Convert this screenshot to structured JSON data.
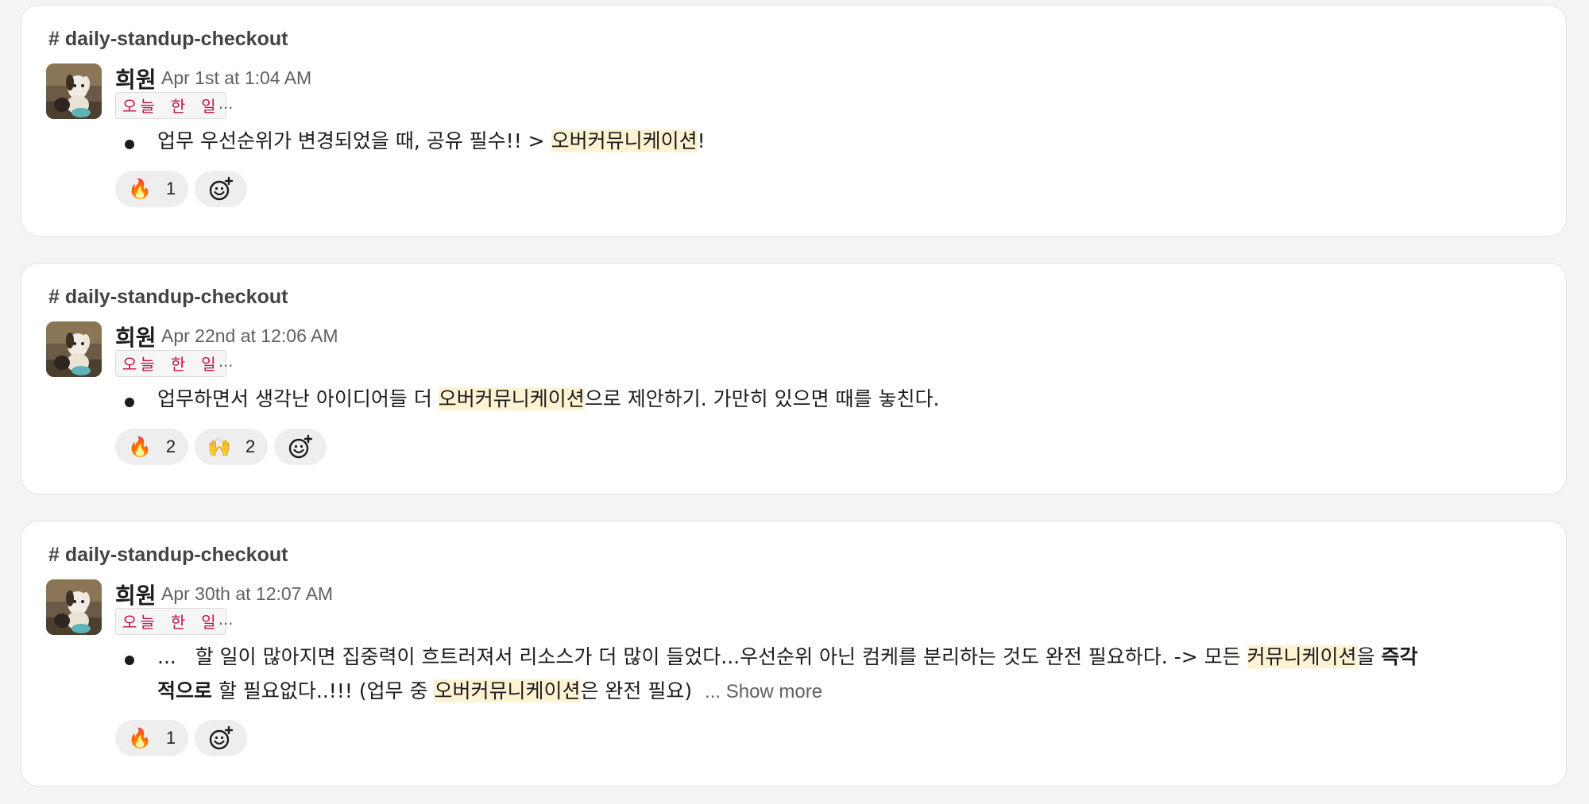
{
  "messages": [
    {
      "channel": "# daily-standup-checkout",
      "author": "희원",
      "timestamp": "Apr 1st at 1:04 AM",
      "tag": "오늘 한 일",
      "ellipsis": "...",
      "text": {
        "p1": "업무 우선순위가 변경되었을 때, 공유 필수!! > ",
        "hl1": "오버커뮤니케이션",
        "p2": "!"
      },
      "reactions": [
        {
          "emoji": "🔥",
          "count": "1"
        }
      ]
    },
    {
      "channel": "# daily-standup-checkout",
      "author": "희원",
      "timestamp": "Apr 22nd at 12:06 AM",
      "tag": "오늘 한 일",
      "ellipsis": "...",
      "text": {
        "p1": "업무하면서 생각난 아이디어들 더 ",
        "hl1": "오버커뮤니케이션",
        "p2": "으로 제안하기. 가만히 있으면 때를 놓친다."
      },
      "reactions": [
        {
          "emoji": "🔥",
          "count": "2"
        },
        {
          "emoji": "🙌",
          "count": "2"
        }
      ]
    },
    {
      "channel": "# daily-standup-checkout",
      "author": "희원",
      "timestamp": "Apr 30th at 12:07 AM",
      "tag": "오늘 한 일",
      "ellipsis": "...",
      "text": {
        "lead": "...",
        "p1": "할 일이 많아지면 집중력이 흐트러져서 리소스가 더 많이 들었다...우선순위 아닌 컴케를 분리하는 것도 완전 필요하다. -> 모든 ",
        "hl1": "커뮤니케이션",
        "p2": "을 ",
        "bold1": "즉각",
        "bold2": "적으로",
        "p3": " 할 필요없다..!!! (업무 중 ",
        "hl2": "오버커뮤니케이션",
        "p4": "은 완전 필요)",
        "show_more": "... Show more"
      },
      "reactions": [
        {
          "emoji": "🔥",
          "count": "1"
        }
      ]
    }
  ]
}
